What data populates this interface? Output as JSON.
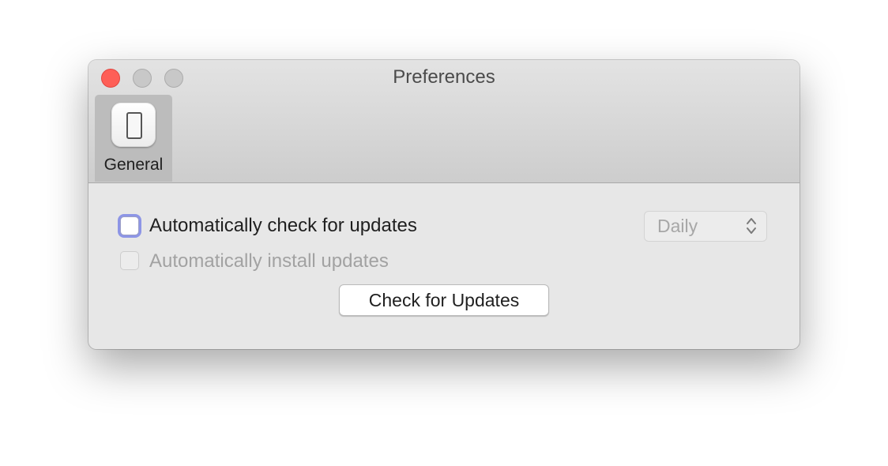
{
  "window": {
    "title": "Preferences"
  },
  "toolbar": {
    "tabs": [
      {
        "label": "General",
        "icon": "device-toggle-icon",
        "selected": true
      }
    ]
  },
  "general": {
    "auto_check": {
      "label": "Automatically check for updates",
      "checked": false,
      "focused": true
    },
    "auto_install": {
      "label": "Automatically install updates",
      "checked": false,
      "enabled": false
    },
    "frequency": {
      "value": "Daily",
      "enabled": false
    },
    "check_button_label": "Check for Updates"
  },
  "colors": {
    "close_button": "#fe5f57",
    "focus_ring": "#8d95e6",
    "disabled_text": "#a2a2a2"
  }
}
